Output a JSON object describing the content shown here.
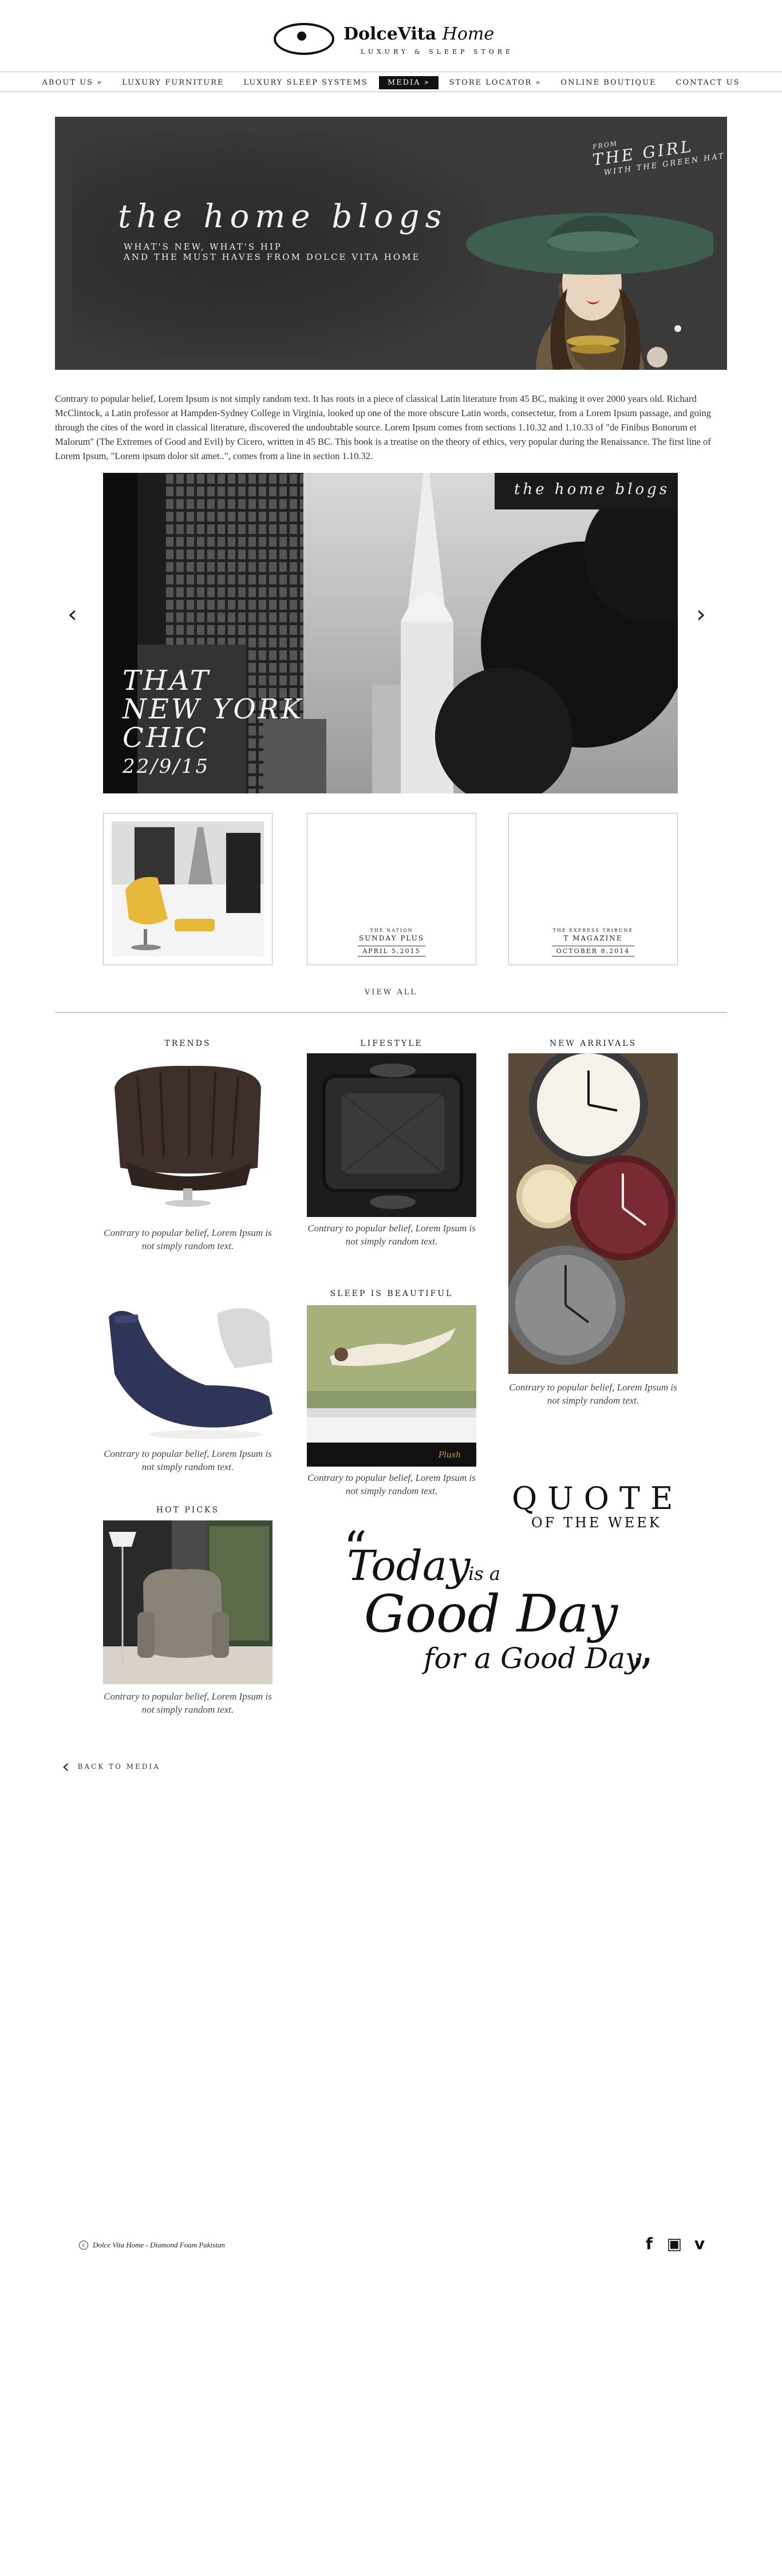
{
  "brand": {
    "name": "DolceVita",
    "name_script": "Home",
    "tagline": "LUXURY & SLEEP STORE"
  },
  "nav": {
    "items": [
      {
        "label": "ABOUT US »"
      },
      {
        "label": "LUXURY FURNITURE"
      },
      {
        "label": "LUXURY SLEEP SYSTEMS"
      },
      {
        "label": "MEDIA »"
      },
      {
        "label": "STORE LOCATOR »"
      },
      {
        "label": "ONLINE BOUTIQUE"
      },
      {
        "label": "CONTACT US"
      }
    ],
    "active_index": 3
  },
  "banner": {
    "title": "the home blogs",
    "sub_line1": "WHAT'S NEW, WHAT'S HIP",
    "sub_line2": "AND THE MUST HAVES FROM DOLCE VITA HOME",
    "from": "FROM",
    "girl": "THE GIRL",
    "hat": "WITH THE GREEN HAT"
  },
  "intro": "Contrary to popular belief, Lorem Ipsum is not simply random text. It has roots in a piece of classical Latin literature from 45 BC, making it over 2000 years old. Richard McClintock, a Latin professor at Hampden-Sydney College in Virginia, looked up one of the more obscure Latin words, consectetur, from a Lorem Ipsum passage, and going through the cites of the word in classical literature, discovered the undoubtable source. Lorem Ipsum comes from sections 1.10.32 and 1.10.33 of \"de Finibus Bonorum et Malorum\" (The Extremes of Good and Evil) by Cicero, written in 45 BC. This book is a treatise on the theory of ethics, very popular during the Renaissance. The first line of Lorem Ipsum, \"Lorem ipsum dolor sit amet..\", comes from a line in section 1.10.32.",
  "slider": {
    "tag": "the home blogs",
    "caption_l1": "THAT",
    "caption_l2": "NEW YORK",
    "caption_l3": "CHIC",
    "caption_date": "22/9/15",
    "prev": "‹",
    "next": "›"
  },
  "thumbs": [
    {
      "small": "",
      "main": "",
      "date": ""
    },
    {
      "small": "THE NATION",
      "main": "SUNDAY PLUS",
      "date": "APRIL 5,2015"
    },
    {
      "small": "THE EXPRESS TRIBUNE",
      "main": "T MAGAZINE",
      "date": "OCTOBER 8,2014"
    }
  ],
  "view_all": "VIEW ALL",
  "sections": {
    "trends": "TRENDS",
    "lifestyle": "LIFESTYLE",
    "new_arrivals": "NEW ARRIVALS",
    "sleep": "SLEEP IS BEAUTIFUL",
    "hot_picks": "HOT PICKS"
  },
  "card_text": "Contrary to popular belief, Lorem Ipsum is not simply random text.",
  "quote": {
    "heading": "QUOTE",
    "subheading": "OF THE WEEK",
    "l1": "Today",
    "l1b": "is a",
    "l2": "Good Day",
    "l3": "for a Good Day"
  },
  "back": {
    "chev": "‹",
    "label": "BACK TO MEDIA"
  },
  "footer": {
    "copy": "Dolce Vita Home - Diamond Foam Pakistan",
    "c": "c"
  },
  "social": {
    "facebook": "f",
    "instagram": "▣",
    "vimeo": "v"
  }
}
